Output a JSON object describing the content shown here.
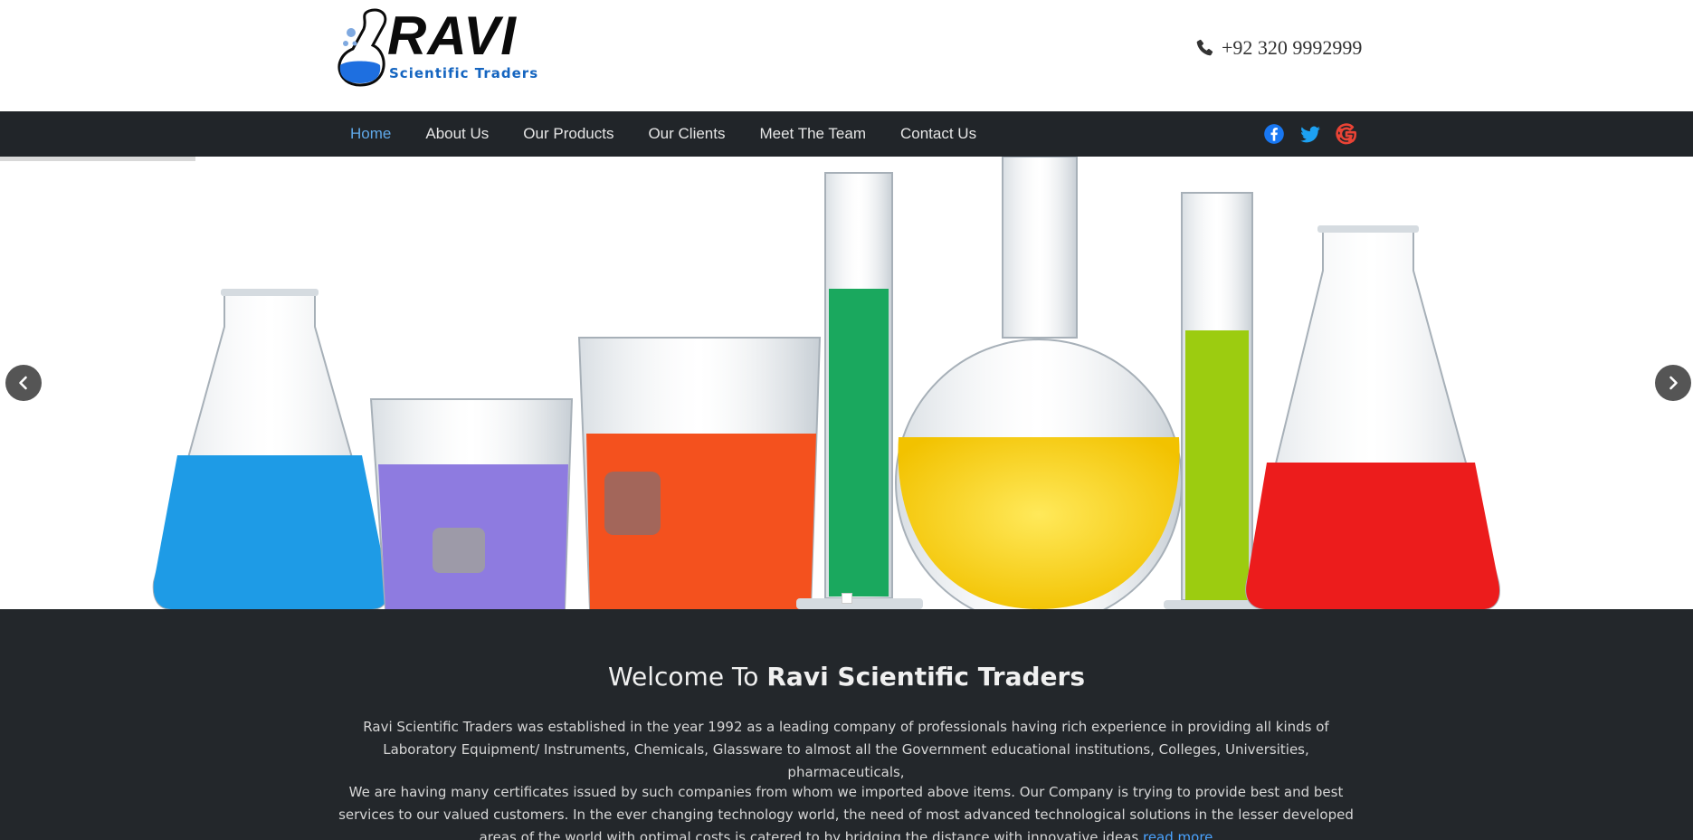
{
  "brand": {
    "name": "RAVI",
    "tagline": "Scientific Traders"
  },
  "header": {
    "phone": "+92 320 9992999",
    "phone_icon": "phone-icon"
  },
  "nav": {
    "items": [
      {
        "label": "Home",
        "active": true
      },
      {
        "label": "About Us"
      },
      {
        "label": "Our Products"
      },
      {
        "label": "Our Clients"
      },
      {
        "label": "Meet The Team"
      },
      {
        "label": "Contact Us"
      }
    ],
    "social": [
      {
        "name": "facebook-icon",
        "color": "#1877f2"
      },
      {
        "name": "twitter-icon",
        "color": "#1da1f2"
      },
      {
        "name": "google-icon",
        "color": "#ea4335"
      }
    ]
  },
  "slider": {
    "prev_icon": "chevron-left-icon",
    "next_icon": "chevron-right-icon",
    "slide_count": 1,
    "active_slide": 1
  },
  "welcome": {
    "title_prefix": "Welcome To",
    "title_bold": "Ravi Scientific Traders",
    "para1": "Ravi Scientific Traders was established in the year 1992 as a leading company of professionals having rich experience in providing all kinds of Laboratory Equipment/ Instruments, Chemicals, Glassware to almost all the Government educational institutions, Colleges, Universities, pharmaceuticals,",
    "para2": "We are having many certificates issued by such companies from whom we imported above items. Our Company is trying to provide best and best services to our valued customers. In the ever changing technology world, the need of most advanced technological solutions in the lesser developed areas of the world with optimal costs is catered to by bridging the distance with innovative ideas",
    "read_more": "read more"
  },
  "colors": {
    "navbar_bg": "#212529",
    "nav_active": "#5fa8e8",
    "welcome_bg": "#23272b",
    "link": "#4aa3ff",
    "brand_blue": "#1565c0"
  }
}
